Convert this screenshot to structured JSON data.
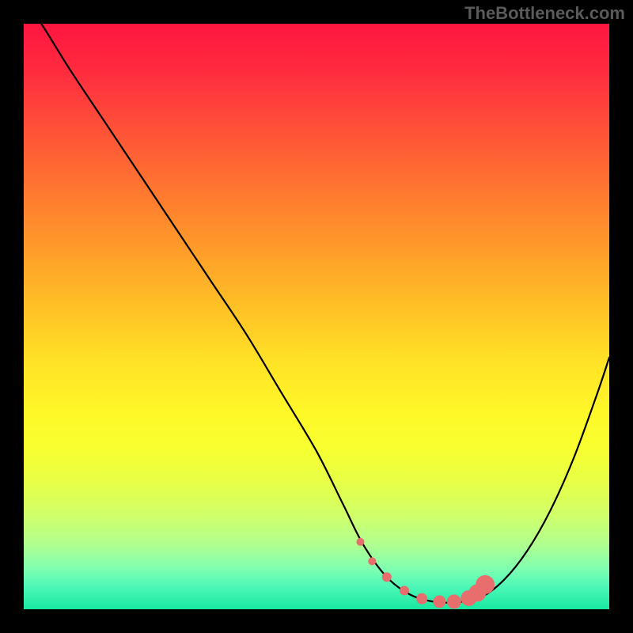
{
  "watermark": "TheBottleneck.com",
  "chart_data": {
    "type": "line",
    "title": "",
    "xlabel": "",
    "ylabel": "",
    "xlim": [
      0,
      100
    ],
    "ylim": [
      0,
      100
    ],
    "series": [
      {
        "name": "curve",
        "x": [
          0,
          3,
          8,
          14,
          20,
          26,
          32,
          38,
          44,
          50,
          54.5,
          58,
          62,
          66,
          70,
          74,
          78,
          82,
          86,
          90,
          94,
          98,
          100
        ],
        "values": [
          104,
          100,
          92,
          83,
          74,
          65,
          56,
          47,
          37,
          27,
          18,
          11,
          5.5,
          2.5,
          1.3,
          1.2,
          2.0,
          5.0,
          10,
          17,
          26,
          37,
          43
        ]
      }
    ],
    "markers": {
      "x": [
        57.5,
        59.5,
        62,
        65,
        68,
        71,
        73.5,
        76,
        77.5,
        78.8
      ],
      "values": [
        11.5,
        8.2,
        5.5,
        3.2,
        1.8,
        1.3,
        1.3,
        1.9,
        2.8,
        4.2
      ],
      "radius": [
        5,
        5,
        6,
        6,
        7,
        8,
        9,
        10,
        11,
        12
      ]
    }
  }
}
